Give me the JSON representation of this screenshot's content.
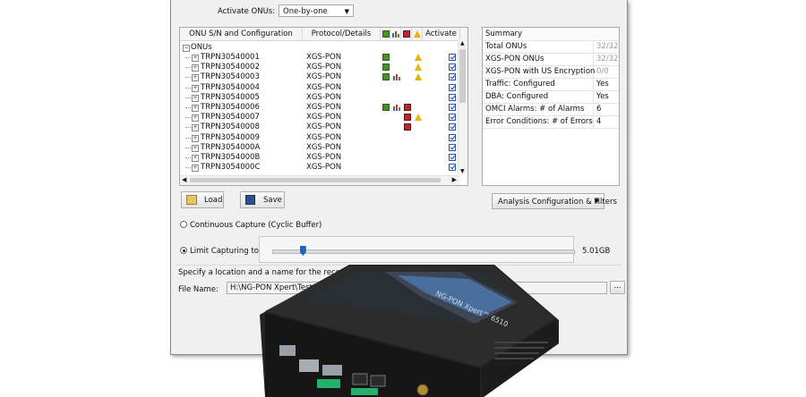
{
  "activate": {
    "label": "Activate ONUs:",
    "value": "One-by-one"
  },
  "tree": {
    "columns": [
      "ONU S/N and Configuration",
      "Protocol/Details",
      "Activate"
    ],
    "root": "ONUs",
    "rows": [
      {
        "sn": "TRPN30540001",
        "protocol": "XGS-PON",
        "traffic": true,
        "dba": false,
        "alarm": false,
        "warn": true,
        "active": true
      },
      {
        "sn": "TRPN30540002",
        "protocol": "XGS-PON",
        "traffic": true,
        "dba": false,
        "alarm": false,
        "warn": true,
        "active": true
      },
      {
        "sn": "TRPN30540003",
        "protocol": "XGS-PON",
        "traffic": true,
        "dba": true,
        "alarm": false,
        "warn": true,
        "active": true
      },
      {
        "sn": "TRPN30540004",
        "protocol": "XGS-PON",
        "traffic": false,
        "dba": false,
        "alarm": false,
        "warn": false,
        "active": true
      },
      {
        "sn": "TRPN30540005",
        "protocol": "XGS-PON",
        "traffic": false,
        "dba": false,
        "alarm": false,
        "warn": false,
        "active": true
      },
      {
        "sn": "TRPN30540006",
        "protocol": "XGS-PON",
        "traffic": true,
        "dba": true,
        "alarm": true,
        "warn": false,
        "active": true
      },
      {
        "sn": "TRPN30540007",
        "protocol": "XGS-PON",
        "traffic": false,
        "dba": false,
        "alarm": true,
        "warn": true,
        "active": true
      },
      {
        "sn": "TRPN30540008",
        "protocol": "XGS-PON",
        "traffic": false,
        "dba": false,
        "alarm": true,
        "warn": false,
        "active": true
      },
      {
        "sn": "TRPN30540009",
        "protocol": "XGS-PON",
        "traffic": false,
        "dba": false,
        "alarm": false,
        "warn": false,
        "active": true
      },
      {
        "sn": "TRPN3054000A",
        "protocol": "XGS-PON",
        "traffic": false,
        "dba": false,
        "alarm": false,
        "warn": false,
        "active": true
      },
      {
        "sn": "TRPN3054000B",
        "protocol": "XGS-PON",
        "traffic": false,
        "dba": false,
        "alarm": false,
        "warn": false,
        "active": true
      },
      {
        "sn": "TRPN3054000C",
        "protocol": "XGS-PON",
        "traffic": false,
        "dba": false,
        "alarm": false,
        "warn": false,
        "active": true
      }
    ]
  },
  "summary": {
    "title": "Summary",
    "rows": [
      {
        "label": "Total ONUs",
        "value": "32/32",
        "muted": true
      },
      {
        "label": "XGS-PON ONUs",
        "value": "32/32",
        "muted": true
      },
      {
        "label": "XGS-PON with US Encryption",
        "value": "0/0",
        "muted": true
      },
      {
        "label": "Traffic: Configured",
        "value": "Yes",
        "muted": false
      },
      {
        "label": "DBA: Configured",
        "value": "Yes",
        "muted": false
      },
      {
        "label": "OMCI Alarms: # of Alarms",
        "value": "6",
        "muted": false
      },
      {
        "label": "Error Conditions: # of Errors",
        "value": "4",
        "muted": false
      }
    ]
  },
  "buttons": {
    "load": "Load",
    "save": "Save",
    "analysis": "Analysis Configuration & Filters"
  },
  "capture": {
    "continuous": "Continuous Capture (Cyclic Buffer)",
    "limit": "Limit Capturing to:",
    "limit_value": "5.01GB",
    "slider_level": 0.1
  },
  "recording": {
    "prompt": "Specify a location and a name for the recording:",
    "file_label": "File Name:",
    "file_value": "H:\\NG-PON Xpert\\Test17.gtss",
    "browse": "..."
  },
  "device": {
    "label": "NG-PON Xpert™ 6510"
  },
  "colors": {
    "accent": "#1d63c8",
    "traffic": "#4a8f2c",
    "alarm": "#b52a2a",
    "warn": "#e7b400"
  }
}
